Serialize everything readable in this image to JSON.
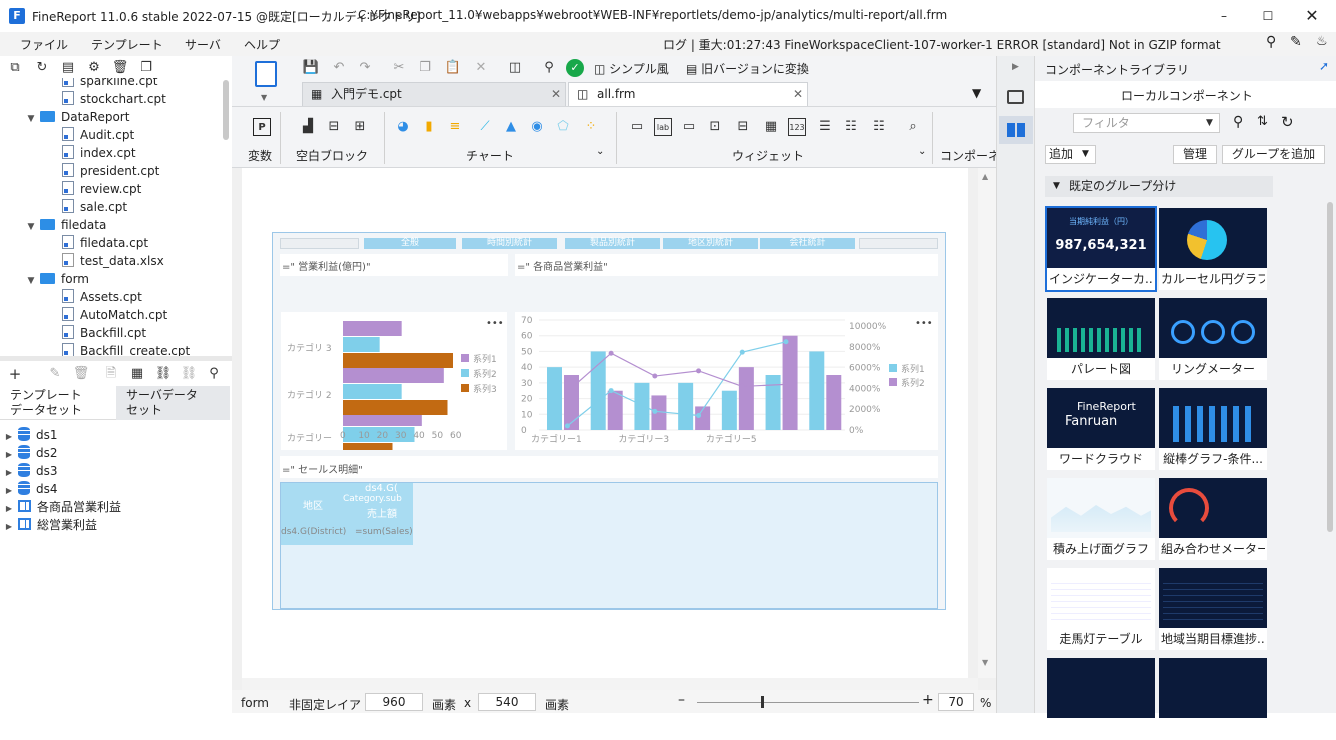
{
  "window": {
    "title": "FineReport 11.0.6 stable 2022-07-15 @既定[ローカルディレクトリ]",
    "path": "C:¥FineReport_11.0¥webapps¥webroot¥WEB-INF¥reportlets/demo-jp/analytics/multi-report/all.frm"
  },
  "menu": [
    "ファイル",
    "テンプレート",
    "サーバ",
    "ヘルプ"
  ],
  "log": "ログ | 重大:01:27:43 FineWorkspaceClient-107-worker-1 ERROR [standard] Not in GZIP format",
  "tree": [
    {
      "label": "sparkline.cpt",
      "type": "file",
      "indent": 2
    },
    {
      "label": "stockchart.cpt",
      "type": "file",
      "indent": 2
    },
    {
      "label": "DataReport",
      "type": "folder",
      "indent": 1
    },
    {
      "label": "Audit.cpt",
      "type": "file",
      "indent": 2
    },
    {
      "label": "index.cpt",
      "type": "file",
      "indent": 2
    },
    {
      "label": "president.cpt",
      "type": "file",
      "indent": 2
    },
    {
      "label": "review.cpt",
      "type": "file",
      "indent": 2
    },
    {
      "label": "sale.cpt",
      "type": "file",
      "indent": 2
    },
    {
      "label": "filedata",
      "type": "folder",
      "indent": 1
    },
    {
      "label": "filedata.cpt",
      "type": "file",
      "indent": 2
    },
    {
      "label": "test_data.xlsx",
      "type": "doc",
      "indent": 2
    },
    {
      "label": "form",
      "type": "folder",
      "indent": 1
    },
    {
      "label": "Assets.cpt",
      "type": "file",
      "indent": 2
    },
    {
      "label": "AutoMatch.cpt",
      "type": "file",
      "indent": 2
    },
    {
      "label": "Backfill.cpt",
      "type": "file",
      "indent": 2
    },
    {
      "label": "Backfill_create.cpt",
      "type": "file",
      "indent": 2
    }
  ],
  "dstabs": [
    "テンプレート\nデータセット",
    "サーバデータ\nセット"
  ],
  "datasets": [
    {
      "label": "ds1",
      "type": "db"
    },
    {
      "label": "ds2",
      "type": "db"
    },
    {
      "label": "ds3",
      "type": "db"
    },
    {
      "label": "ds4",
      "type": "db"
    },
    {
      "label": "各商品営業利益",
      "type": "table"
    },
    {
      "label": "総営業利益",
      "type": "table"
    }
  ],
  "tabs": [
    {
      "label": "入門デモ.cpt"
    },
    {
      "label": "all.frm"
    }
  ],
  "widgetgroups": [
    "変数",
    "空白ブロック",
    "チャート",
    "ウィジェット",
    "コンポーネ"
  ],
  "canvas": {
    "nav": [
      "全般",
      "時間別統計",
      "製品別統計",
      "地区別統計",
      "会社統計"
    ],
    "chart1_title": "=\"  営業利益(億円)\"",
    "chart2_title": "=\"  各商品営業利益\"",
    "table_title": "=\"  セールス明細\"",
    "table": {
      "h1": "地区",
      "h2": "ds4.G(",
      "h3": "Category.sub",
      "h4": "売上額",
      "c1": "ds4.G(District)",
      "c2": "=sum(Sales)"
    }
  },
  "chart_data": [
    {
      "type": "bar",
      "orientation": "horizontal",
      "categories": [
        "カテゴリ 3",
        "カテゴリ 2",
        "カテゴリー"
      ],
      "series": [
        {
          "name": "系列1",
          "color": "#b48fd0",
          "values": [
            32,
            55,
            43
          ]
        },
        {
          "name": "系列2",
          "color": "#7fcfea",
          "values": [
            20,
            32,
            39
          ]
        },
        {
          "name": "系列3",
          "color": "#c26a12",
          "values": [
            60,
            57,
            27
          ]
        }
      ],
      "xticks": [
        "0",
        "10",
        "20",
        "30",
        "40",
        "50",
        "60"
      ],
      "xlim": [
        0,
        60
      ]
    },
    {
      "type": "bar+line",
      "categories": [
        "カテゴリー1",
        "",
        "カテゴリー3",
        "",
        "カテゴリー5",
        ""
      ],
      "yticks_left": [
        "0",
        "10",
        "20",
        "30",
        "40",
        "50",
        "60",
        "70"
      ],
      "yticks_right": [
        "0%",
        "2000%",
        "4000%",
        "6000%",
        "8000%",
        "10000%"
      ],
      "series": [
        {
          "name": "系列1",
          "color": "#7fcfea",
          "values": [
            40,
            50,
            30,
            30,
            25,
            35,
            50
          ]
        },
        {
          "name": "系列2",
          "color": "#b48fd0",
          "values": [
            35,
            25,
            22,
            15,
            40,
            60,
            35
          ]
        }
      ],
      "lines": [
        {
          "color": "#7fcfea",
          "values": [
            400,
            3800,
            1800,
            1400,
            7500,
            8500
          ]
        },
        {
          "color": "#b48fd0",
          "values": [
            3700,
            7400,
            5200,
            5700,
            4200,
            4400
          ]
        }
      ]
    }
  ],
  "statusbar": {
    "mode": "form",
    "layout": "非固定レイア",
    "width": "960",
    "height": "540",
    "unit": "画素",
    "x": "x",
    "zoom": "70",
    "pct": "%"
  },
  "library": {
    "title": "コンポーネントライブラリ",
    "local": "ローカルコンポーネント",
    "filter": "フィルタ",
    "add": "追加",
    "manage": "管理",
    "addgroup": "グループを追加",
    "group": "既定のグループ分け",
    "cards": [
      {
        "label": "インジケーターカ..."
      },
      {
        "label": "カルーセル円グラフ"
      },
      {
        "label": "パレート図"
      },
      {
        "label": "リングメーター"
      },
      {
        "label": "ワードクラウド"
      },
      {
        "label": "縦棒グラフ-条件..."
      },
      {
        "label": "積み上げ面グラフ"
      },
      {
        "label": "組み合わせメーター"
      },
      {
        "label": "走馬灯テーブル"
      },
      {
        "label": "地域当期目標進捗..."
      },
      {
        "label": ""
      },
      {
        "label": ""
      }
    ],
    "card1_title": "当期純利益（円）",
    "card1_value": "987,654,321",
    "card4_title": "Fanruan",
    "card4_sub": "FineReport"
  }
}
